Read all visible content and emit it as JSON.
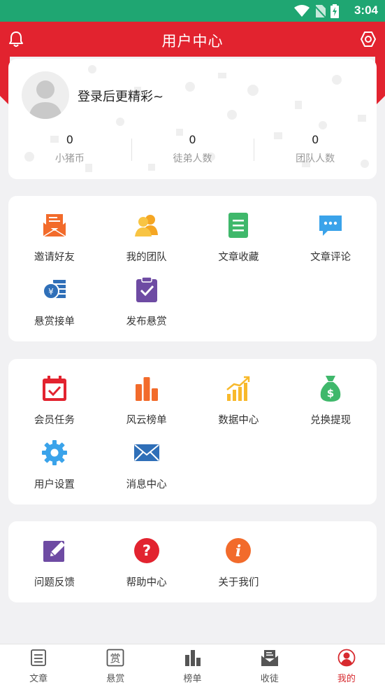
{
  "status_bar": {
    "time": "3:04"
  },
  "header": {
    "title": "用户中心"
  },
  "profile": {
    "login_prompt": "登录后更精彩~",
    "stats": [
      {
        "value": "0",
        "label": "小猪币"
      },
      {
        "value": "0",
        "label": "徒弟人数"
      },
      {
        "value": "0",
        "label": "团队人数"
      }
    ]
  },
  "section1": {
    "items": [
      {
        "label": "邀请好友",
        "icon": "invite-envelope-icon",
        "color": "#f26b2b"
      },
      {
        "label": "我的团队",
        "icon": "team-icon",
        "color": "#f8b92b"
      },
      {
        "label": "文章收藏",
        "icon": "document-icon",
        "color": "#3fb86b"
      },
      {
        "label": "文章评论",
        "icon": "comment-bubble-icon",
        "color": "#3aa3ea"
      },
      {
        "label": "悬赏接单",
        "icon": "coin-stack-icon",
        "color": "#2f6fb8"
      },
      {
        "label": "发布悬赏",
        "icon": "clipboard-check-icon",
        "color": "#6e4ba3"
      }
    ]
  },
  "section2": {
    "items": [
      {
        "label": "会员任务",
        "icon": "calendar-check-icon",
        "color": "#e2232f"
      },
      {
        "label": "风云榜单",
        "icon": "bar-chart-icon",
        "color": "#f26b2b"
      },
      {
        "label": "数据中心",
        "icon": "growth-chart-icon",
        "color": "#f8b92b"
      },
      {
        "label": "兑换提现",
        "icon": "money-bag-icon",
        "color": "#3fb86b"
      },
      {
        "label": "用户设置",
        "icon": "gear-icon",
        "color": "#3aa3ea"
      },
      {
        "label": "消息中心",
        "icon": "mail-icon",
        "color": "#2f6fb8"
      }
    ]
  },
  "section3": {
    "items": [
      {
        "label": "问题反馈",
        "icon": "edit-icon",
        "color": "#6e4ba3"
      },
      {
        "label": "帮助中心",
        "icon": "question-icon",
        "color": "#e2232f"
      },
      {
        "label": "关于我们",
        "icon": "info-icon",
        "color": "#f26b2b"
      }
    ]
  },
  "tabbar": {
    "items": [
      {
        "label": "文章",
        "icon": "article-icon"
      },
      {
        "label": "悬赏",
        "icon": "reward-icon",
        "glyph": "赏"
      },
      {
        "label": "榜单",
        "icon": "ranking-icon"
      },
      {
        "label": "收徒",
        "icon": "recruit-icon"
      },
      {
        "label": "我的",
        "icon": "profile-icon",
        "active": true
      }
    ],
    "active_color": "#d72a2f"
  }
}
